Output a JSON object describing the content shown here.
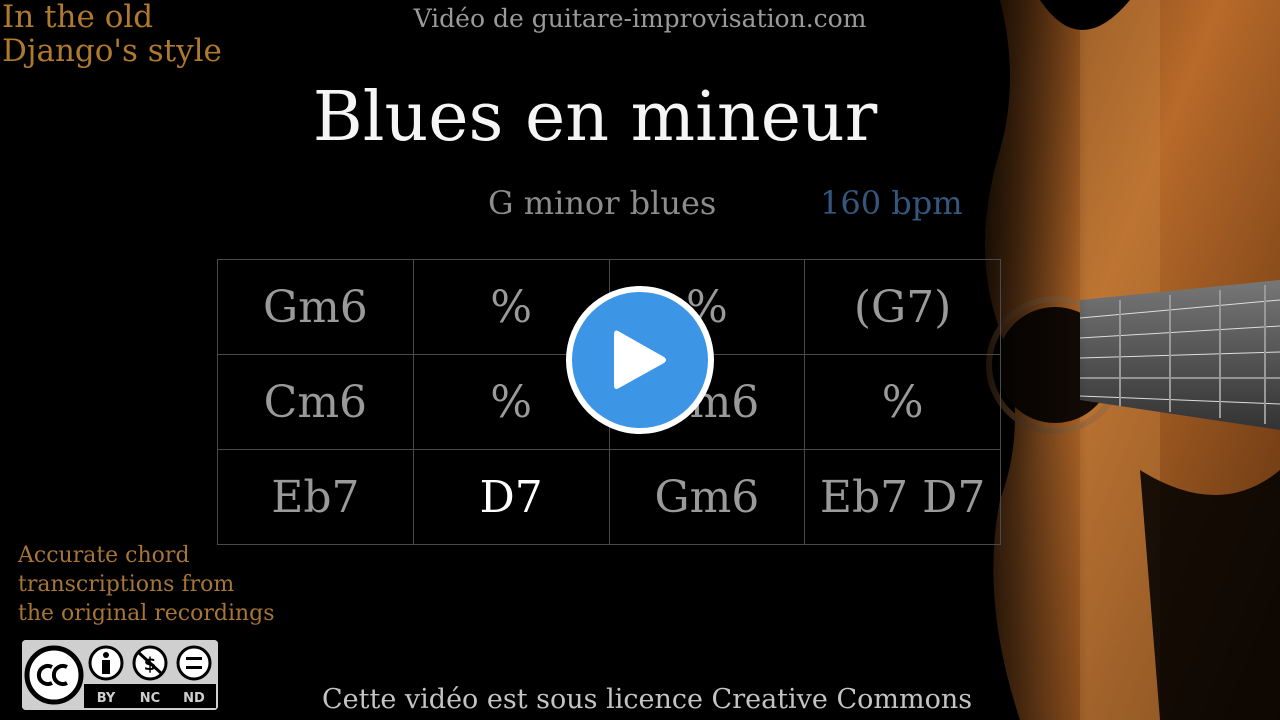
{
  "header": {
    "style_badge_line1": "In the old",
    "style_badge_line2": "Django's style",
    "site": "Vidéo de guitare-improvisation.com"
  },
  "title": "Blues en mineur",
  "subtitle": "G minor blues",
  "tempo": "160 bpm",
  "chords": {
    "rows": [
      [
        "Gm6",
        "%",
        "%",
        "(G7)"
      ],
      [
        "Cm6",
        "%",
        "Gm6",
        "%"
      ],
      [
        "Eb7",
        "D7",
        "Gm6",
        "Eb7 D7"
      ]
    ],
    "active_chord": "D7"
  },
  "footer_note": {
    "line1": "Accurate chord",
    "line2": "transcriptions from",
    "line3": "the original recordings"
  },
  "cc_badge": {
    "labels": [
      "BY",
      "NC",
      "ND"
    ]
  },
  "license": "Cette vidéo est sous licence Creative Commons",
  "colors": {
    "background": "#000000",
    "title": "#f5f5f5",
    "chords": "#9a9a9a",
    "active_chord": "#ffffff",
    "tempo": "#34577f",
    "accent_gold": "#b07a2e",
    "play_button": "#3d95e6"
  },
  "icons": {
    "play": "play-icon",
    "creative_commons": "cc-icon",
    "attribution": "by-icon",
    "non_commercial": "nc-icon",
    "no_derivatives": "nd-icon"
  }
}
